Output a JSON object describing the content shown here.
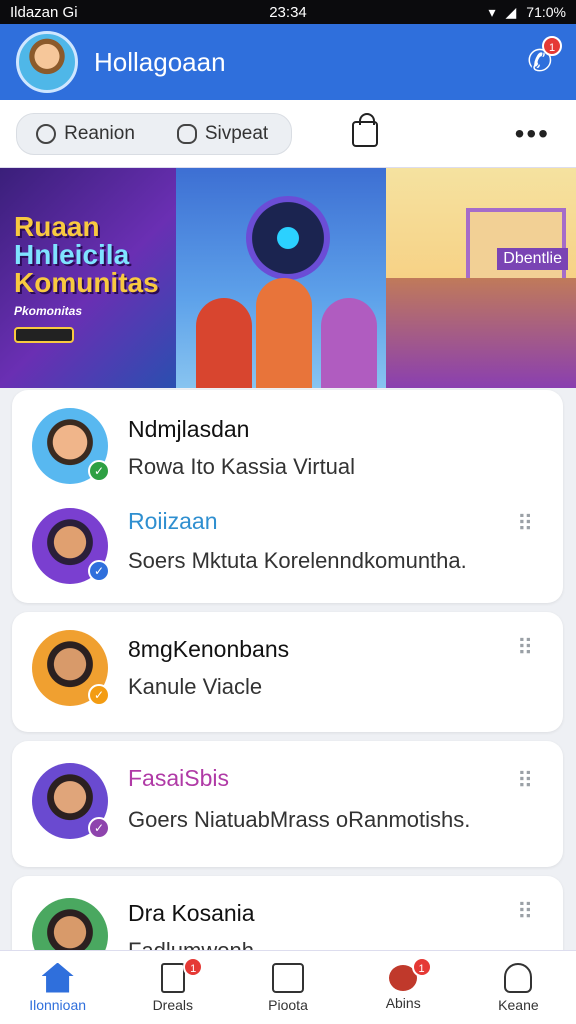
{
  "status_bar": {
    "left": "Ildazan Gi",
    "time": "23:34",
    "battery": "71:0%"
  },
  "app_bar": {
    "title": "Hollagoaan",
    "call_badge": "1"
  },
  "toolbar": {
    "seg1": "Reanion",
    "seg2": "Sivpeat"
  },
  "banner": {
    "title_line1": "Ruaan",
    "title_line2": "Hnleicila",
    "title_line3": "Komunitas",
    "subtitle": "Pkomonitas",
    "sign": "Dbentlie"
  },
  "cards": [
    {
      "rows": [
        {
          "name": "Ndmjlasdan",
          "subtitle": "Rowa Ito Kassia Virtual",
          "name_color": "#111111",
          "badge_color": "#2ea043"
        },
        {
          "name": "Roiizaan",
          "subtitle": "Soers Mktuta Korelenndkomuntha.",
          "name_color": "#2f8fd0",
          "badge_color": "#2f6fdc"
        }
      ]
    },
    {
      "rows": [
        {
          "name": "8mgKenonbans",
          "subtitle": "Kanule Viacle",
          "name_color": "#111111",
          "badge_color": "#f39c12"
        }
      ]
    },
    {
      "rows": [
        {
          "name": "FasaiSbis",
          "subtitle": "Goers NiatuabMrass oRanmotishs.",
          "name_color": "#b03aa6",
          "badge_color": "#8e44ad"
        }
      ]
    },
    {
      "rows": [
        {
          "name": "Dra Kosania",
          "subtitle": "Fadlumwonh",
          "name_color": "#111111",
          "badge_color": "#2f6fdc"
        }
      ]
    }
  ],
  "nav": [
    {
      "label": "Ilonnioan",
      "icon": "home-icon",
      "badge": ""
    },
    {
      "label": "Dreals",
      "icon": "document-icon",
      "badge": "1"
    },
    {
      "label": "Pioota",
      "icon": "house-icon",
      "badge": ""
    },
    {
      "label": "Abins",
      "icon": "chat-bubble-icon",
      "badge": "1"
    },
    {
      "label": "Keane",
      "icon": "person-icon",
      "badge": ""
    }
  ]
}
